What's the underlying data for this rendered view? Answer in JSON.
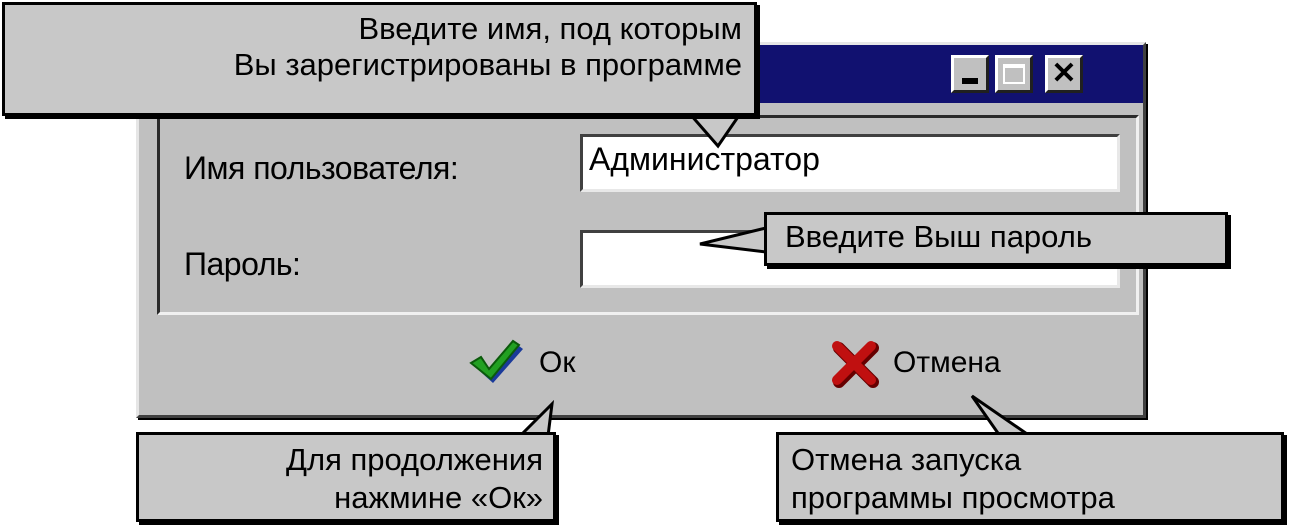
{
  "window": {
    "buttons": {
      "minimize": "_",
      "maximize": "□",
      "close": "✕"
    }
  },
  "form": {
    "username_label": "Имя пользователя:",
    "username_value": "Администратор",
    "password_label": "Пароль:",
    "password_value": ""
  },
  "actions": {
    "ok_label": "Ок",
    "ok_icon": "checkmark-icon",
    "cancel_label": "Отмена",
    "cancel_icon": "x-icon"
  },
  "callouts": {
    "username_hint_line1": "Введите имя, под которым",
    "username_hint_line2": "Вы зарегистрированы в программе",
    "password_hint": "Введите Выш пароль",
    "ok_hint_line1": "Для продолжения",
    "ok_hint_line2": "нажмине «Ок»",
    "cancel_hint_line1": "Отмена запуска",
    "cancel_hint_line2": "программы просмотра"
  },
  "colors": {
    "titlebar": "#111170",
    "window_face": "#c0c0c0",
    "callout_bg": "#c8c8c8",
    "ok_check": "#22a022",
    "cancel_x": "#c01010"
  }
}
